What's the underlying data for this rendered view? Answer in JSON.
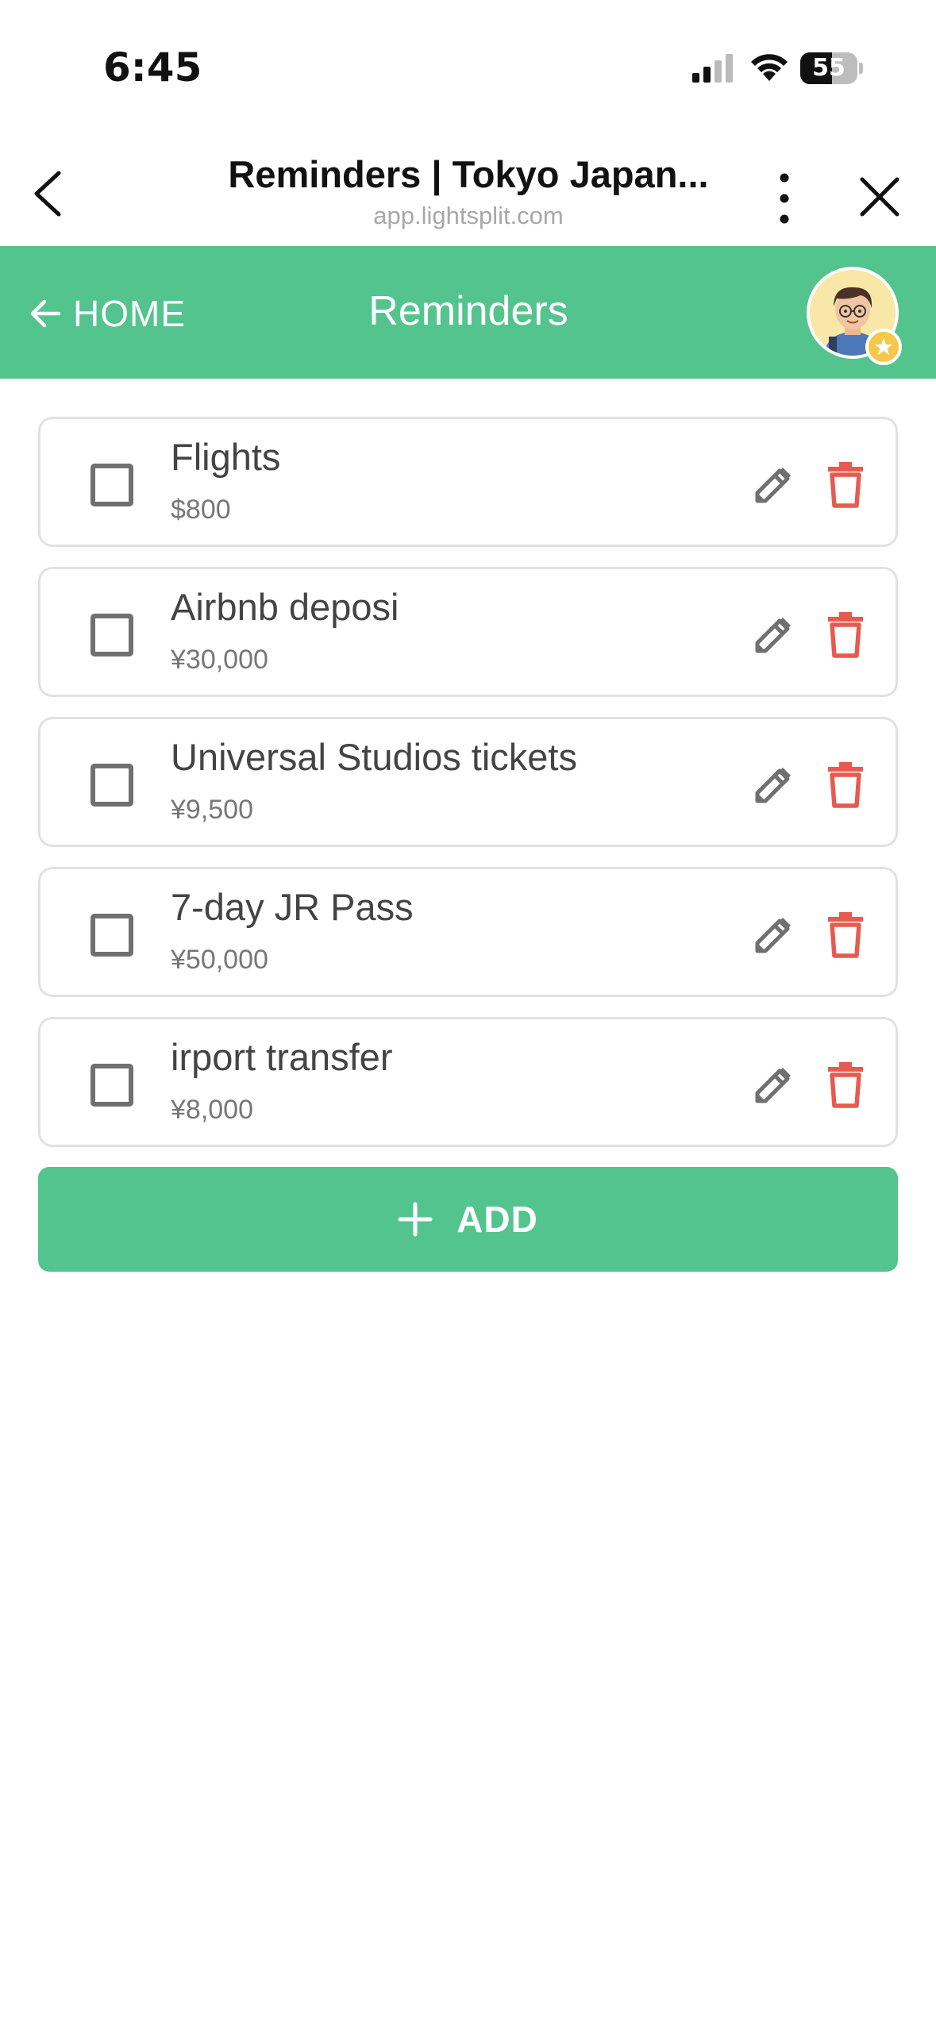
{
  "status_bar": {
    "time": "6:45",
    "battery": "55"
  },
  "browser": {
    "title": "Reminders | Tokyo Japan...",
    "url": "app.lightsplit.com"
  },
  "header": {
    "back_label": "HOME",
    "title": "Reminders",
    "accent_color": "#54c48e"
  },
  "reminders": [
    {
      "name": "Flights",
      "amount": "$800",
      "checked": false
    },
    {
      "name": "Airbnb deposi",
      "amount": "¥30,000",
      "checked": false
    },
    {
      "name": "Universal Studios tickets",
      "amount": "¥9,500",
      "checked": false
    },
    {
      "name": "7-day JR Pass",
      "amount": "¥50,000",
      "checked": false
    },
    {
      "name": "irport transfer",
      "amount": "¥8,000",
      "checked": false
    }
  ],
  "add_button": {
    "label": "ADD"
  },
  "icons": {
    "edit": "pencil-icon",
    "delete": "trash-icon",
    "back": "arrow-left-icon",
    "close": "close-icon",
    "menu": "more-vertical-icon"
  },
  "colors": {
    "delete": "#e85a50",
    "edit": "#707070"
  }
}
